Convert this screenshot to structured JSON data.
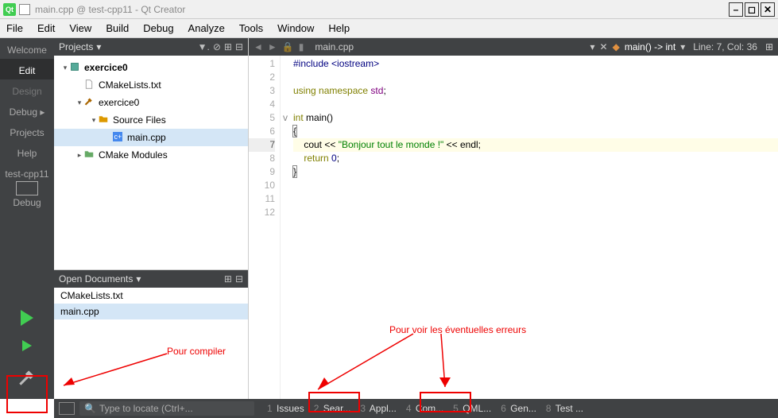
{
  "window": {
    "title": "main.cpp @ test-cpp11 - Qt Creator",
    "logo_text": "Qt"
  },
  "menubar": [
    "File",
    "Edit",
    "View",
    "Build",
    "Debug",
    "Analyze",
    "Tools",
    "Window",
    "Help"
  ],
  "left_rail": {
    "modes": [
      {
        "label": "Welcome",
        "active": false
      },
      {
        "label": "Edit",
        "active": true
      },
      {
        "label": "Design",
        "active": false
      },
      {
        "label": "Debug ▸",
        "active": false
      },
      {
        "label": "Projects",
        "active": false
      },
      {
        "label": "Help",
        "active": false
      }
    ],
    "project_selector": "test-cpp11",
    "project_config": "Debug"
  },
  "projects_panel": {
    "title": "Projects",
    "tree": [
      {
        "indent": 0,
        "expanded": true,
        "label": "exercice0",
        "bold": true,
        "icon": "project"
      },
      {
        "indent": 1,
        "expanded": null,
        "label": "CMakeLists.txt",
        "icon": "file"
      },
      {
        "indent": 1,
        "expanded": true,
        "label": "exercice0",
        "icon": "hammer"
      },
      {
        "indent": 2,
        "expanded": true,
        "label": "Source Files",
        "icon": "folder"
      },
      {
        "indent": 3,
        "expanded": null,
        "label": "main.cpp",
        "icon": "cpp",
        "selected": true
      },
      {
        "indent": 1,
        "expanded": false,
        "label": "CMake Modules",
        "icon": "folder-g"
      }
    ]
  },
  "open_docs": {
    "title": "Open Documents",
    "items": [
      {
        "label": "CMakeLists.txt",
        "selected": false
      },
      {
        "label": "main.cpp",
        "selected": true
      }
    ]
  },
  "editor": {
    "filename": "main.cpp",
    "symbol": "main() -> int",
    "cursor": "Line: 7, Col: 36",
    "lines": 12,
    "current_line": 7
  },
  "code": {
    "l1_pp": "#include ",
    "l1_inc": "<iostream>",
    "l3_kw1": "using",
    "l3_kw2": "namespace",
    "l3_ns": "std",
    "l3_end": ";",
    "l5_ty": "int",
    "l5_fn": " main()",
    "l6": "{",
    "l7_a": "    cout << ",
    "l7_str": "\"Bonjour tout le monde !\"",
    "l7_b": " << endl;",
    "l10_kw": "return",
    "l10_b": " ",
    "l10_num": "0",
    "l10_c": ";",
    "l11": "}"
  },
  "status": {
    "search_placeholder": "Type to locate (Ctrl+...",
    "tabs": [
      {
        "n": "1",
        "label": "Issues"
      },
      {
        "n": "2",
        "label": "Sear..."
      },
      {
        "n": "3",
        "label": "Appl..."
      },
      {
        "n": "4",
        "label": "Com..."
      },
      {
        "n": "5",
        "label": "QML..."
      },
      {
        "n": "6",
        "label": "Gen..."
      },
      {
        "n": "8",
        "label": "Test ..."
      }
    ]
  },
  "annotations": {
    "compile": "Pour compiler",
    "errors": "Pour voir les éventuelles erreurs"
  }
}
